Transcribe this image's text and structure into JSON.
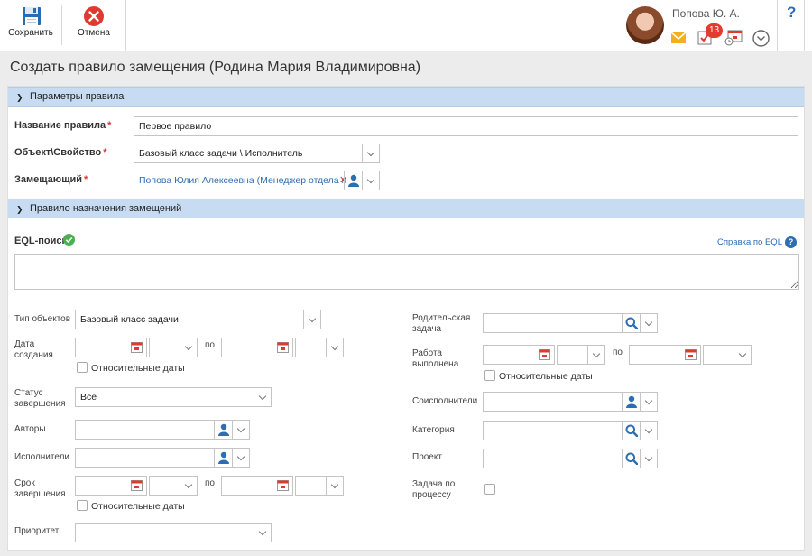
{
  "toolbar": {
    "save_label": "Сохранить",
    "cancel_label": "Отмена",
    "user_name": "Попова Ю. А.",
    "notifications_count": "13",
    "help_label": "?"
  },
  "page": {
    "title": "Создать правило замещения (Родина Мария Владимировна)"
  },
  "section_params": {
    "title": "Параметры правила",
    "rule_name_label": "Название правила",
    "rule_name_value": "Первое правило",
    "object_label": "Объект\\Свойство",
    "object_value": "Базовый класс задачи \\ Исполнитель",
    "substitute_label": "Замещающий",
    "substitute_value": "Попова Юлия Алексеевна (Менеджер отдела про",
    "required_mark": "*"
  },
  "section_rule": {
    "title": "Правило назначения замещений",
    "eql_label": "EQL-поиск",
    "eql_help_link": "Справка по EQL",
    "eql_help_icon": "?",
    "left": {
      "object_type_label": "Тип объектов",
      "object_type_value": "Базовый класс задачи",
      "created_label": "Дата создания",
      "to_label": "по",
      "relative_dates": "Относительные даты",
      "status_label": "Статус завершения",
      "status_value": "Все",
      "authors_label": "Авторы",
      "executors_label": "Исполнители",
      "deadline_label": "Срок завершения",
      "priority_label": "Приоритет"
    },
    "right": {
      "parent_task_label": "Родительская задача",
      "work_done_label": "Работа выполнена",
      "to_label": "по",
      "relative_dates": "Относительные даты",
      "coexecutors_label": "Соисполнители",
      "category_label": "Категория",
      "project_label": "Проект",
      "process_task_label": "Задача по процессу"
    }
  },
  "colors": {
    "accent": "#2d6db3",
    "section_header": "#c7dcf3",
    "required": "#dd3333",
    "badge": "#e33b2e",
    "eql_ok": "#4caf50"
  }
}
